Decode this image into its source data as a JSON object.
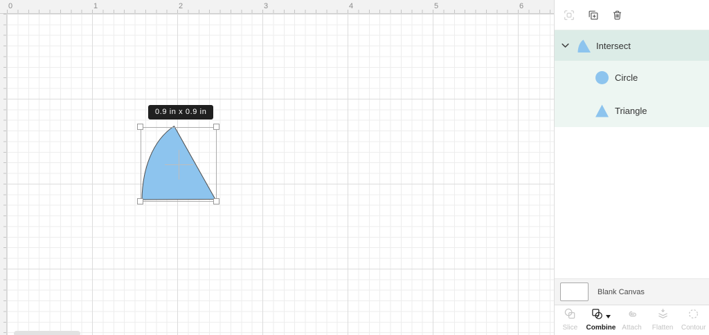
{
  "canvas": {
    "ruler_h_labels": [
      "0",
      "1",
      "2",
      "3",
      "4",
      "5",
      "6"
    ],
    "size_tooltip": "0.9 in x 0.9 in",
    "selection": {
      "width_in": "0.9",
      "height_in": "0.9"
    }
  },
  "panel": {
    "toolbar": {
      "icons": [
        "multi-select",
        "duplicate",
        "trash"
      ]
    },
    "layers": {
      "group": {
        "label": "Intersect",
        "expanded": true
      },
      "children": [
        {
          "label": "Circle",
          "shape": "circle"
        },
        {
          "label": "Triangle",
          "shape": "triangle"
        }
      ]
    },
    "canvas_row": {
      "label": "Blank Canvas"
    },
    "tools": [
      {
        "label": "Slice",
        "enabled": false
      },
      {
        "label": "Combine",
        "enabled": true
      },
      {
        "label": "Attach",
        "enabled": false
      },
      {
        "label": "Flatten",
        "enabled": false
      },
      {
        "label": "Contour",
        "enabled": false
      }
    ]
  },
  "colors": {
    "shape_blue": "#8DC4EE",
    "shape_stroke": "#4D4D4D",
    "selected_row_bg": "#DCECE7",
    "children_bg": "#EDF6F2",
    "tooltip_bg": "#202020"
  }
}
